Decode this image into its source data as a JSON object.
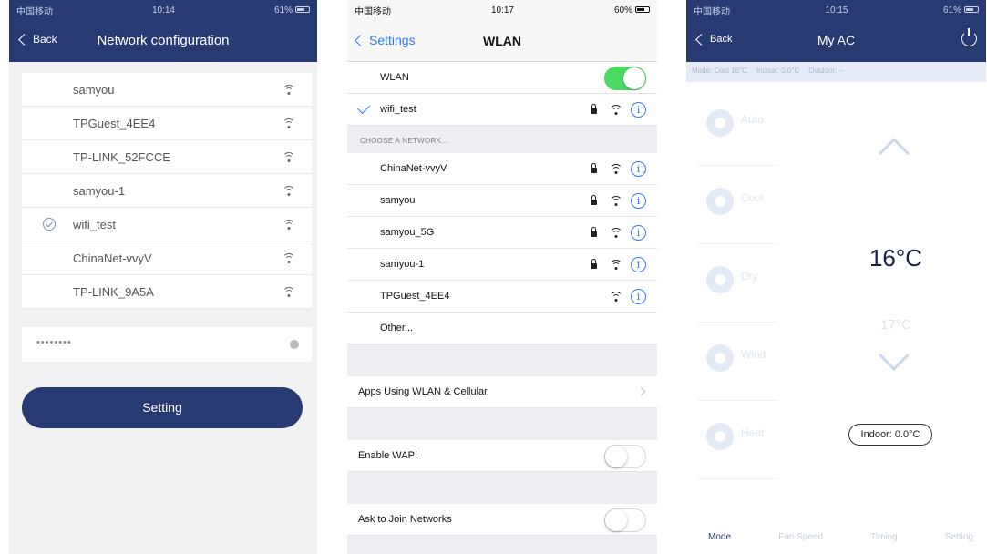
{
  "screen1": {
    "status": {
      "carrier": "中国移动",
      "time": "10:14",
      "battery": "61%"
    },
    "nav": {
      "back_label": "Back",
      "title": "Network configuration"
    },
    "networks": [
      {
        "name": "samyou",
        "selected": false
      },
      {
        "name": "TPGuest_4EE4",
        "selected": false
      },
      {
        "name": "TP-LINK_52FCCE",
        "selected": false
      },
      {
        "name": "samyou-1",
        "selected": false
      },
      {
        "name": "wifi_test",
        "selected": true
      },
      {
        "name": "ChinaNet-vvyV",
        "selected": false
      },
      {
        "name": "TP-LINK_9A5A",
        "selected": false
      }
    ],
    "password": {
      "value": "••••••••"
    },
    "setting_button": "Setting",
    "accent_color": "#283a72"
  },
  "screen2": {
    "status": {
      "carrier": "中国移动",
      "time": "10:17",
      "battery": "60%"
    },
    "nav": {
      "back_label": "Settings",
      "title": "WLAN"
    },
    "wlan_label": "WLAN",
    "wlan_on": true,
    "connected": {
      "name": "wifi_test"
    },
    "choose_header": "CHOOSE A NETWORK...",
    "networks": [
      {
        "name": "ChinaNet-vvyV",
        "locked": true
      },
      {
        "name": "samyou",
        "locked": true
      },
      {
        "name": "samyou_5G",
        "locked": true
      },
      {
        "name": "samyou-1",
        "locked": true
      },
      {
        "name": "TPGuest_4EE4",
        "locked": false
      }
    ],
    "other_label": "Other...",
    "apps_label": "Apps Using WLAN & Cellular",
    "wapi_label": "Enable WAPI",
    "wapi_on": false,
    "ask_label": "Ask to Join Networks",
    "ask_on": false,
    "toggle_on_color": "#4bd963",
    "link_color": "#2f7bf6"
  },
  "screen3": {
    "status": {
      "carrier": "中国移动",
      "time": "10:15",
      "battery": "61%"
    },
    "nav": {
      "back_label": "Back",
      "title": "My AC"
    },
    "info": {
      "mode": "Mode: Cool 16°C",
      "indoor": "Indoor: 0.0°C",
      "outdoor": "Outdoor: --"
    },
    "modes": [
      "Auto",
      "Cool",
      "Dry",
      "Wind",
      "Heat"
    ],
    "temp_current": "16°C",
    "temp_next": "17°C",
    "indoor_pill": "Indoor: 0.0°C",
    "tabs": [
      "Mode",
      "Fan Speed",
      "Timing",
      "Setting"
    ],
    "active_tab": "Mode"
  }
}
